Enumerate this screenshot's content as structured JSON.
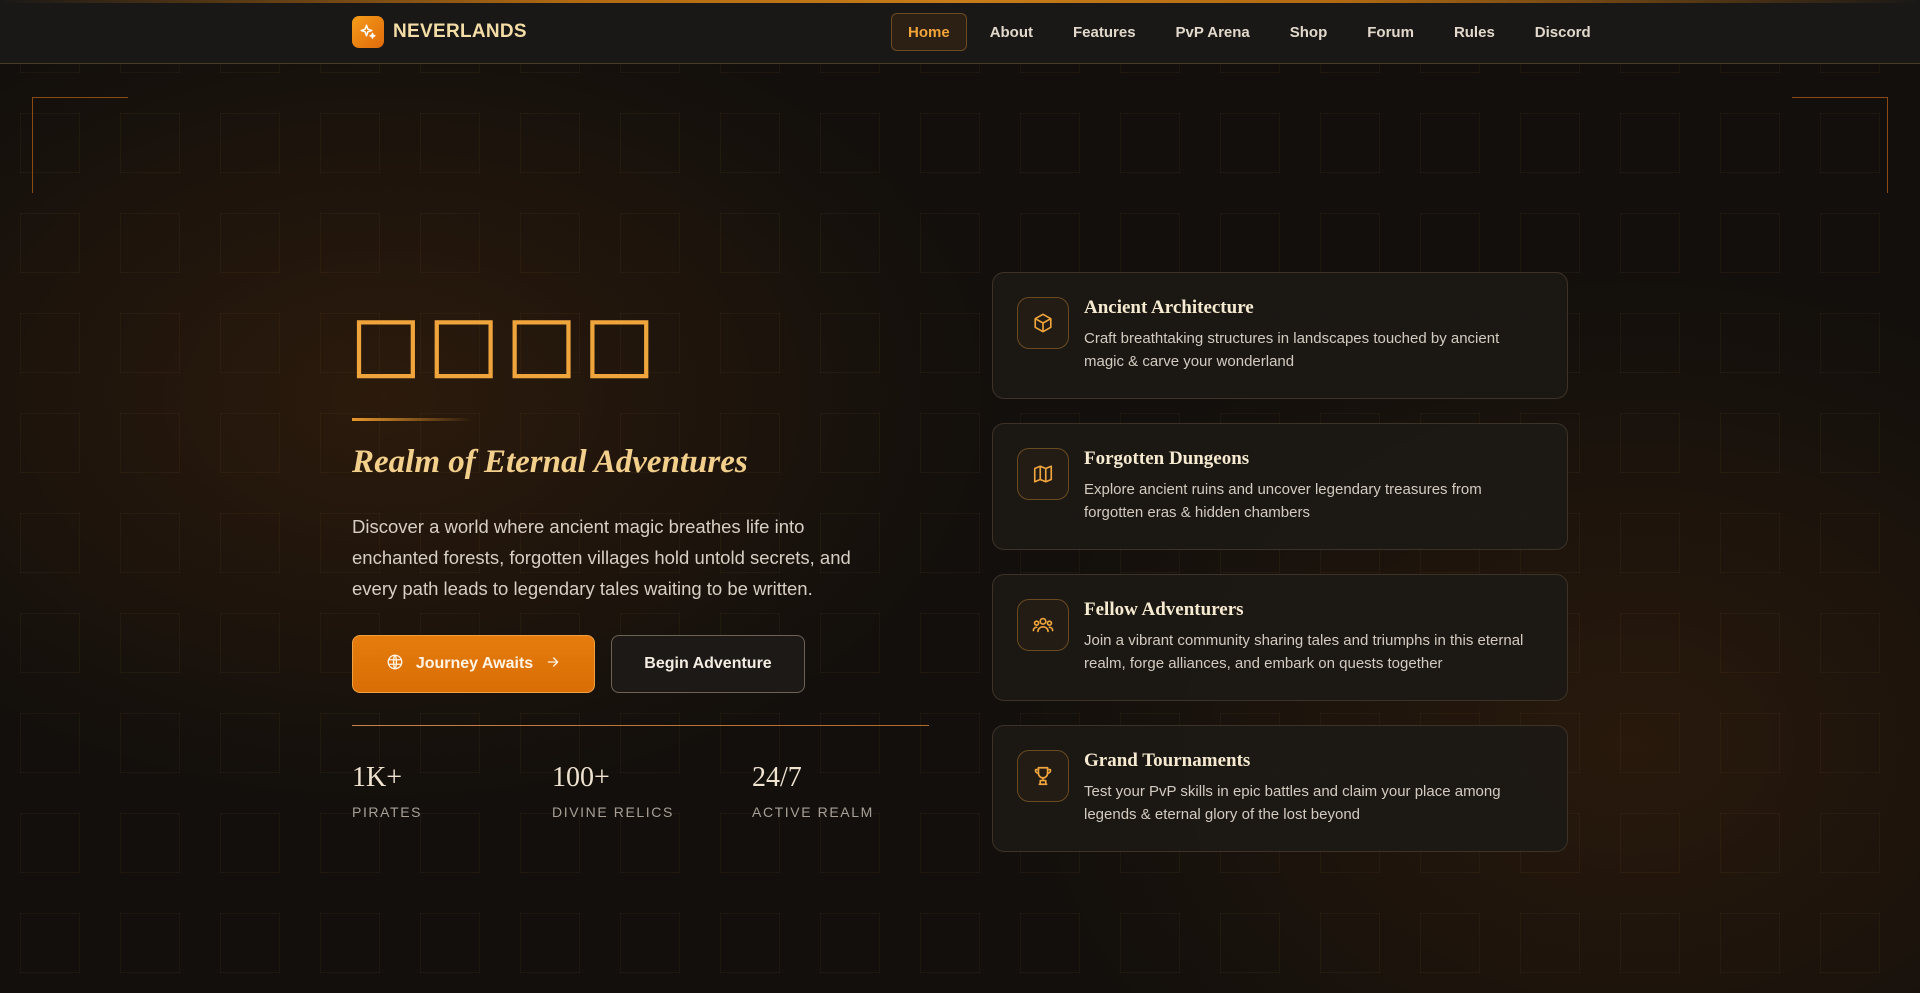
{
  "header": {
    "brand_name": "NEVERLANDS",
    "nav": [
      {
        "label": "Home",
        "active": true
      },
      {
        "label": "About"
      },
      {
        "label": "Features"
      },
      {
        "label": "PvP Arena"
      },
      {
        "label": "Shop"
      },
      {
        "label": "Forum"
      },
      {
        "label": "Rules"
      },
      {
        "label": "Discord"
      }
    ]
  },
  "hero": {
    "title": "□□□□",
    "subtitle": "Realm of Eternal Adventures",
    "description": "Discover a world where ancient magic breathes life into enchanted forests, forgotten villages hold untold secrets, and every path leads to legendary tales waiting to be written.",
    "primary_button": "Journey Awaits",
    "secondary_button": "Begin Adventure"
  },
  "stats": [
    {
      "value": "1K+",
      "label": "PIRATES"
    },
    {
      "value": "100+",
      "label": "DIVINE RELICS"
    },
    {
      "value": "24/7",
      "label": "ACTIVE REALM"
    }
  ],
  "features": [
    {
      "icon": "cube-icon",
      "title": "Ancient Architecture",
      "description": "Craft breathtaking structures in landscapes touched by ancient magic & carve your wonderland"
    },
    {
      "icon": "map-icon",
      "title": "Forgotten Dungeons",
      "description": "Explore ancient ruins and uncover legendary treasures from forgotten eras & hidden chambers"
    },
    {
      "icon": "users-icon",
      "title": "Fellow Adventurers",
      "description": "Join a vibrant community sharing tales and triumphs in this eternal realm, forge alliances, and embark on quests together"
    },
    {
      "icon": "trophy-icon",
      "title": "Grand Tournaments",
      "description": "Test your PvP skills in epic battles and claim your place among legends & eternal glory of the lost beyond"
    }
  ],
  "colors": {
    "accent": "#e57c0c",
    "gold": "#f0a43c",
    "background": "#120f0c"
  }
}
